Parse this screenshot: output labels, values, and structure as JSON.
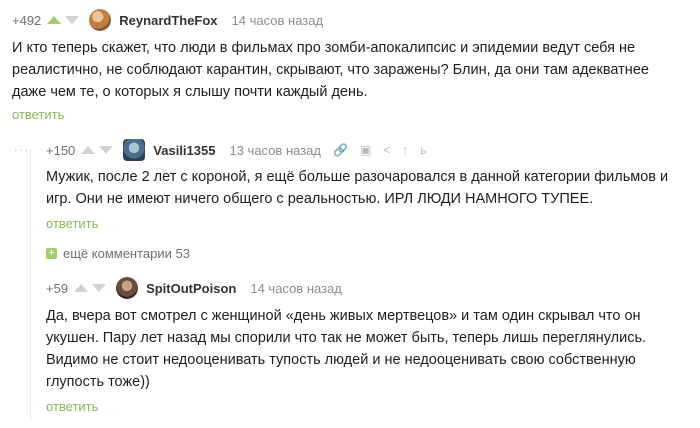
{
  "comments": [
    {
      "rating": "+492",
      "username": "ReynardTheFox",
      "time": "14 часов назад",
      "text": "И кто теперь скажет, что люди в фильмах про зомби-апокалипсис и эпидемии ведут себя не реалистично, не соблюдают карантин, скрывают, что заражены? Блин, да они там адекватнее даже чем те, о которых я слышу почти каждый день.",
      "reply": "ответить"
    },
    {
      "rating": "+150",
      "username": "Vasili1355",
      "time": "13 часов назад",
      "text": "Мужик, после 2 лет с короной, я ещё больше разочаровался в данной категории фильмов и игр. Они не имеют ничего общего с реальностью. ИРЛ ЛЮДИ НАМНОГО ТУПЕЕ.",
      "reply": "ответить",
      "tools": [
        "🔗",
        "▣",
        "<",
        "↑",
        "ь"
      ]
    },
    {
      "rating": "+59",
      "username": "SpitOutPoison",
      "time": "14 часов назад",
      "text": "Да, вчера вот смотрел с женщиной «день живых мертвецов» и там один скрывал что он укушен. Пару лет назад мы спорили что так не может быть, теперь лишь переглянулись. Видимо не стоит недооценивать тупость людей и не недооценивать свою собственную глупость тоже))",
      "reply": "ответить"
    }
  ],
  "more_comments": {
    "icon": "+",
    "label": "ещё комментарии 53"
  },
  "thread_dots": "..."
}
